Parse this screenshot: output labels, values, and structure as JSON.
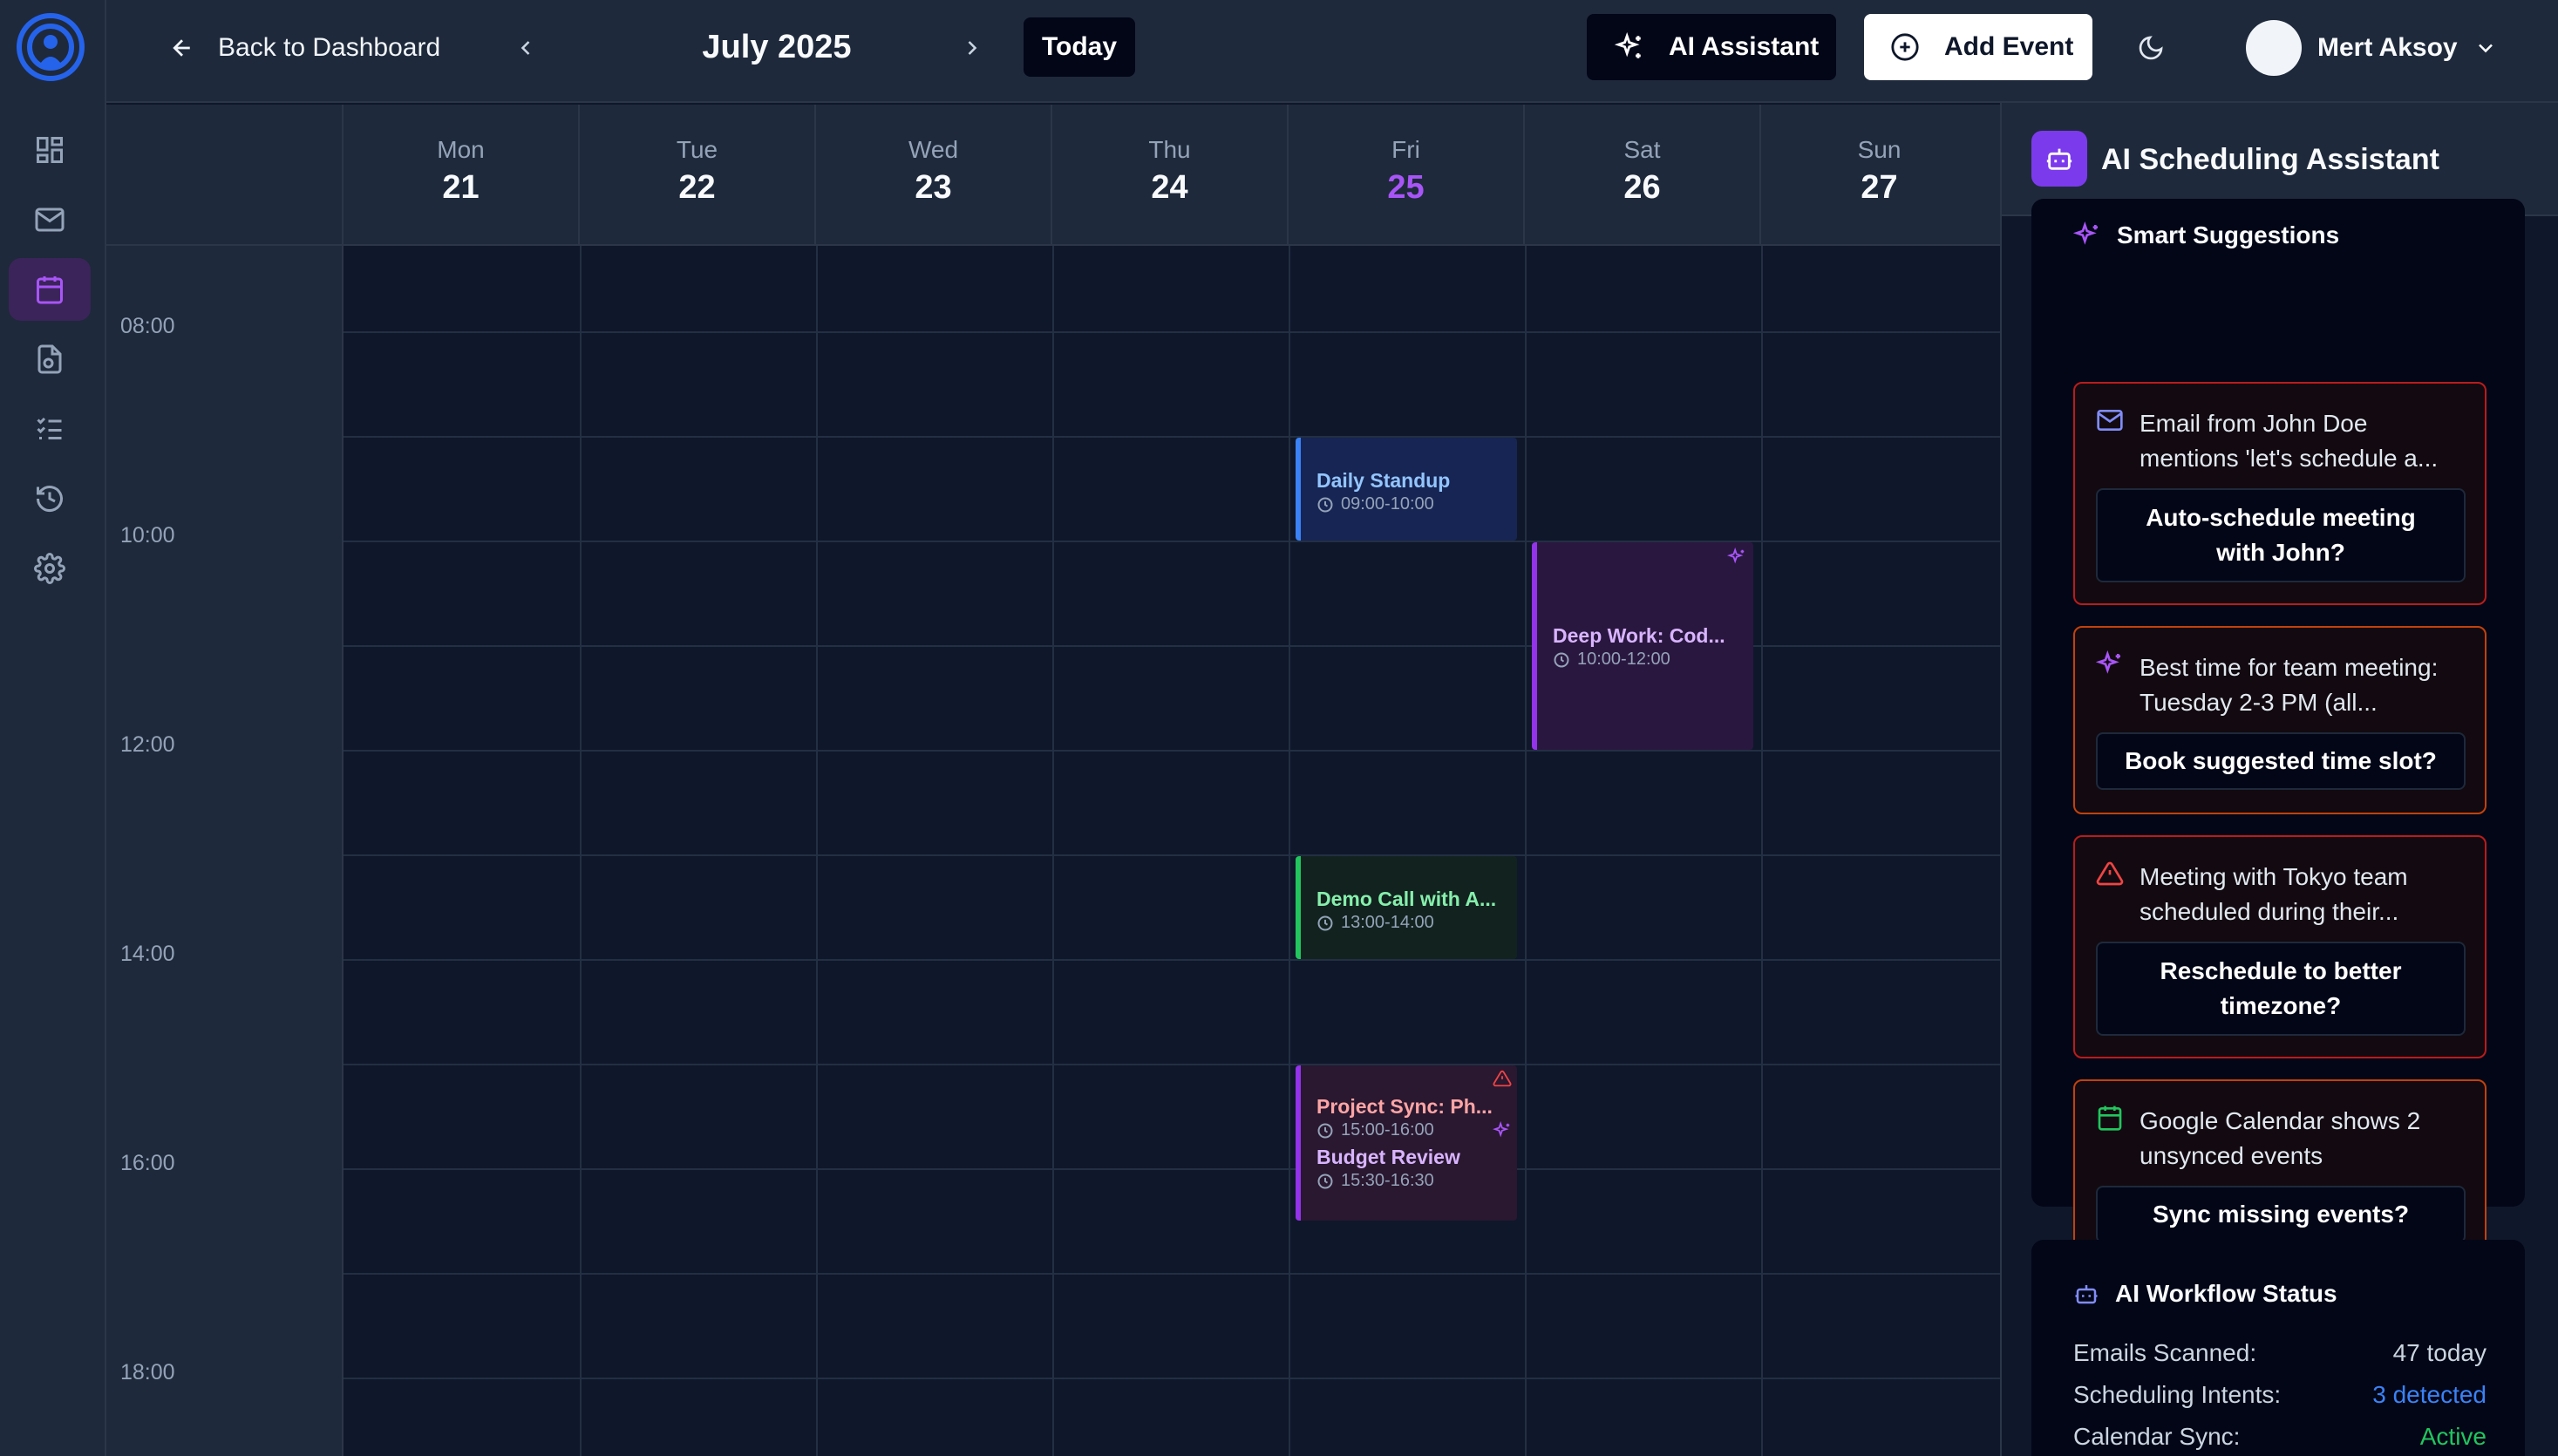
{
  "header": {
    "back_label": "Back to Dashboard",
    "month": "July 2025",
    "today_label": "Today",
    "ai_assistant_label": "AI Assistant",
    "add_event_label": "Add Event",
    "user_name": "Mert Aksoy"
  },
  "sidebar": {
    "items": [
      {
        "name": "dashboard",
        "icon": "grid-icon"
      },
      {
        "name": "mail",
        "icon": "mail-icon"
      },
      {
        "name": "calendar",
        "icon": "calendar-icon",
        "active": true
      },
      {
        "name": "documents",
        "icon": "document-icon"
      },
      {
        "name": "tasks",
        "icon": "checklist-icon"
      },
      {
        "name": "history",
        "icon": "history-icon"
      },
      {
        "name": "settings",
        "icon": "gear-icon"
      }
    ]
  },
  "calendar": {
    "days": [
      {
        "name": "Mon",
        "num": "21"
      },
      {
        "name": "Tue",
        "num": "22"
      },
      {
        "name": "Wed",
        "num": "23"
      },
      {
        "name": "Thu",
        "num": "24"
      },
      {
        "name": "Fri",
        "num": "25",
        "today": true
      },
      {
        "name": "Sat",
        "num": "26"
      },
      {
        "name": "Sun",
        "num": "27"
      }
    ],
    "times": [
      "08:00",
      "10:00",
      "12:00",
      "14:00",
      "16:00",
      "18:00"
    ],
    "events": [
      {
        "title": "Daily Standup",
        "time": "09:00-10:00",
        "day": "Fri",
        "color": "#3b82f6"
      },
      {
        "title": "Deep Work: Cod...",
        "time": "10:00-12:00",
        "day": "Sat",
        "color": "#9333ea",
        "ai_suggested": true
      },
      {
        "title": "Demo Call with A...",
        "time": "13:00-14:00",
        "day": "Fri",
        "color": "#22c55e"
      },
      {
        "title": "Project Sync: Ph...",
        "time": "15:00-16:00",
        "day": "Fri",
        "color": "#ef4444",
        "conflict": true
      },
      {
        "title": "Budget Review",
        "time": "15:30-16:30",
        "day": "Fri",
        "color": "#9333ea",
        "ai_suggested": true
      }
    ]
  },
  "assistant": {
    "title": "AI Scheduling Assistant",
    "smart_suggestions_title": "Smart Suggestions",
    "suggestions": [
      {
        "icon": "mail-icon",
        "text": "Email from John Doe mentions 'let's schedule a...",
        "action": "Auto-schedule meeting with John?",
        "border": "#b91c1c"
      },
      {
        "icon": "sparkle-icon",
        "text": "Best time for team meeting: Tuesday 2-3 PM (all...",
        "action": "Book suggested time slot?",
        "border": "#c2410c"
      },
      {
        "icon": "warning-icon",
        "text": "Meeting with Tokyo team scheduled during their...",
        "action": "Reschedule to better timezone?",
        "border": "#b91c1c"
      },
      {
        "icon": "calendar-icon",
        "text": "Google Calendar shows 2 unsynced events",
        "action": "Sync missing events?",
        "border": "#c2410c"
      }
    ],
    "workflow": {
      "title": "AI Workflow Status",
      "stats": [
        {
          "label": "Emails Scanned:",
          "value": "47 today",
          "color": "#cbd5e1"
        },
        {
          "label": "Scheduling Intents:",
          "value": "3 detected",
          "color": "#3b82f6"
        },
        {
          "label": "Calendar Sync:",
          "value": "Active",
          "color": "#22c55e"
        }
      ]
    }
  },
  "colors": {
    "accent": "#a855f7",
    "background": "#0f172a",
    "panel": "#1e293b"
  }
}
